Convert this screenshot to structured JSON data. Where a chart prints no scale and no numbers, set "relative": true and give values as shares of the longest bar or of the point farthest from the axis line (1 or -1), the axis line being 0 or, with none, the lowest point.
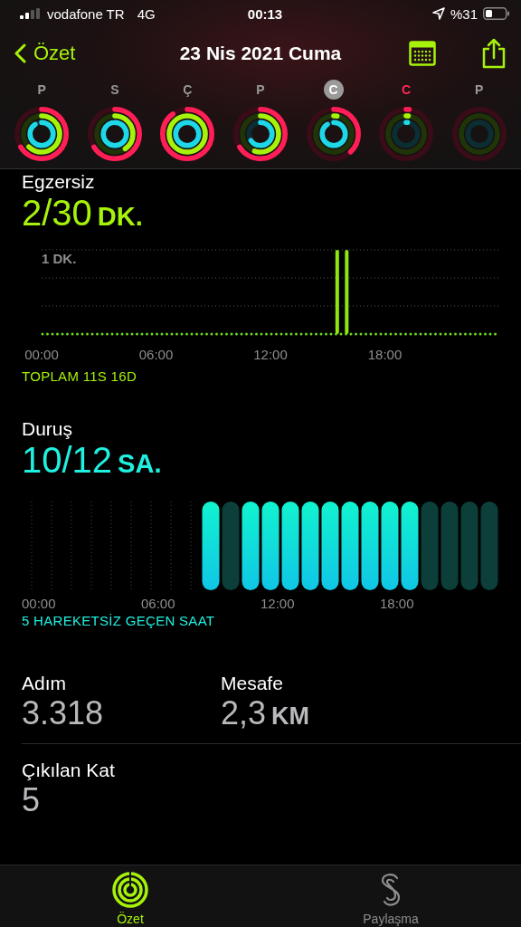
{
  "status_bar": {
    "carrier": "vodafone TR",
    "network": "4G",
    "time": "00:13",
    "battery": "%31"
  },
  "nav": {
    "back": "Özet",
    "title": "23 Nis 2021 Cuma"
  },
  "week": [
    {
      "letter": "P",
      "selected": false,
      "today": false
    },
    {
      "letter": "S",
      "selected": false,
      "today": false
    },
    {
      "letter": "Ç",
      "selected": false,
      "today": false
    },
    {
      "letter": "P",
      "selected": false,
      "today": false
    },
    {
      "letter": "C",
      "selected": true,
      "today": false
    },
    {
      "letter": "C",
      "selected": false,
      "today": true
    },
    {
      "letter": "P",
      "selected": false,
      "today": false
    }
  ],
  "exercise": {
    "label": "Egzersiz",
    "value": "2/30",
    "unit": "DK.",
    "summary": "TOPLAM 11S 16D",
    "chart_data": {
      "type": "bar",
      "x": [
        15.5,
        16
      ],
      "values": [
        1,
        1
      ],
      "xlim": [
        0,
        24
      ],
      "relative": true,
      "xticks": [
        {
          "value": 0,
          "label": "00:00"
        },
        {
          "value": 6,
          "label": "06:00"
        },
        {
          "value": 12,
          "label": "12:00"
        },
        {
          "value": 18,
          "label": "18:00"
        }
      ],
      "annotations": [
        "1 DK."
      ]
    }
  },
  "stand": {
    "label": "Duruş",
    "value": "10/12",
    "unit": "SA.",
    "summary": "5 HAREKETSİZ GEÇEN SAAT",
    "hours": [
      {
        "kind": "empty"
      },
      {
        "kind": "empty"
      },
      {
        "kind": "empty"
      },
      {
        "kind": "empty"
      },
      {
        "kind": "empty"
      },
      {
        "kind": "empty"
      },
      {
        "kind": "empty"
      },
      {
        "kind": "empty"
      },
      {
        "kind": "empty"
      },
      {
        "kind": "stood"
      },
      {
        "kind": "idle"
      },
      {
        "kind": "stood"
      },
      {
        "kind": "stood"
      },
      {
        "kind": "stood"
      },
      {
        "kind": "stood"
      },
      {
        "kind": "stood"
      },
      {
        "kind": "stood"
      },
      {
        "kind": "stood"
      },
      {
        "kind": "stood"
      },
      {
        "kind": "stood"
      },
      {
        "kind": "idle"
      },
      {
        "kind": "idle"
      },
      {
        "kind": "idle"
      },
      {
        "kind": "idle"
      }
    ],
    "axis_labels": [
      "00:00",
      "06:00",
      "12:00",
      "18:00"
    ]
  },
  "stats": [
    {
      "label": "Adım",
      "value": "3.318"
    },
    {
      "label": "Mesafe",
      "value": "2,3",
      "unit": "KM"
    },
    {
      "label": "Çıkılan Kat",
      "value": "5"
    }
  ],
  "tabs": [
    {
      "label": "Özet",
      "selected": true,
      "kind": "rings"
    },
    {
      "label": "Paylaşma",
      "selected": false,
      "kind": "sharing"
    }
  ]
}
